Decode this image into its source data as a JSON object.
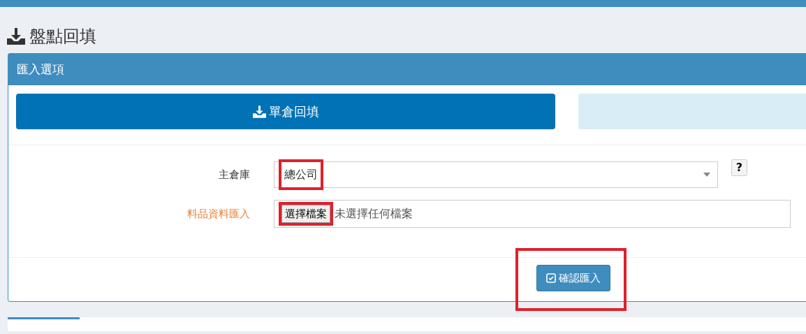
{
  "page_title": "盤點回填",
  "panel": {
    "title": "匯入選項",
    "modes": [
      {
        "label": "單倉回填",
        "selected": true
      },
      {
        "selected": false
      }
    ],
    "fields": [
      {
        "kind": "select",
        "label": "主倉庫",
        "value": "總公司",
        "highlighted": true,
        "help": "?"
      },
      {
        "kind": "file",
        "label": "料品資料匯入",
        "required": true,
        "button": "選擇檔案",
        "status": "未選擇任何檔案",
        "highlighted": true
      }
    ],
    "submit": {
      "label": "確認匯入",
      "highlighted": true
    }
  }
}
